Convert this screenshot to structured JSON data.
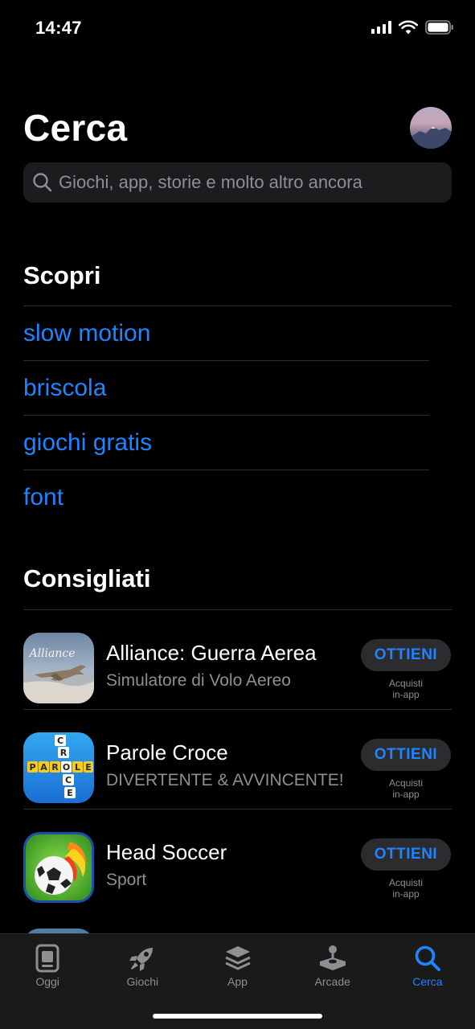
{
  "status_bar": {
    "time": "14:47"
  },
  "header": {
    "title": "Cerca",
    "search_placeholder": "Giochi, app, storie e molto altro ancora"
  },
  "discover": {
    "title": "Scopri",
    "items": [
      "slow motion",
      "briscola",
      "giochi gratis",
      "font"
    ]
  },
  "suggested": {
    "title": "Consigliati",
    "apps": [
      {
        "name": "Alliance: Guerra Aerea",
        "subtitle": "Simulatore di Volo Aereo",
        "button": "OTTIENI",
        "iap_line1": "Acquisti",
        "iap_line2": "in-app",
        "icon": "jet-icon"
      },
      {
        "name": "Parole Croce",
        "subtitle": "DIVERTENTE & AVVINCENTE!",
        "button": "OTTIENI",
        "iap_line1": "Acquisti",
        "iap_line2": "in-app",
        "icon": "crossword-icon"
      },
      {
        "name": "Head Soccer",
        "subtitle": "Sport",
        "button": "OTTIENI",
        "iap_line1": "Acquisti",
        "iap_line2": "in-app",
        "icon": "soccer-ball-icon"
      }
    ]
  },
  "crossword_letters": {
    "vertical": [
      "C",
      "R",
      "O",
      "C",
      "E"
    ],
    "horizontal": [
      "P",
      "A",
      "R",
      "O",
      "L",
      "E"
    ]
  },
  "alliance_logo_text": "Alliance",
  "tab_bar": {
    "active": "Cerca",
    "tabs": [
      {
        "label": "Oggi",
        "icon": "today-icon"
      },
      {
        "label": "Giochi",
        "icon": "rocket-icon"
      },
      {
        "label": "App",
        "icon": "layers-icon"
      },
      {
        "label": "Arcade",
        "icon": "joystick-icon"
      },
      {
        "label": "Cerca",
        "icon": "search-icon"
      }
    ]
  },
  "colors": {
    "accent": "#1f84ff",
    "background": "#000000",
    "secondary_text": "#8e8e93",
    "fill": "#1c1c1e"
  }
}
